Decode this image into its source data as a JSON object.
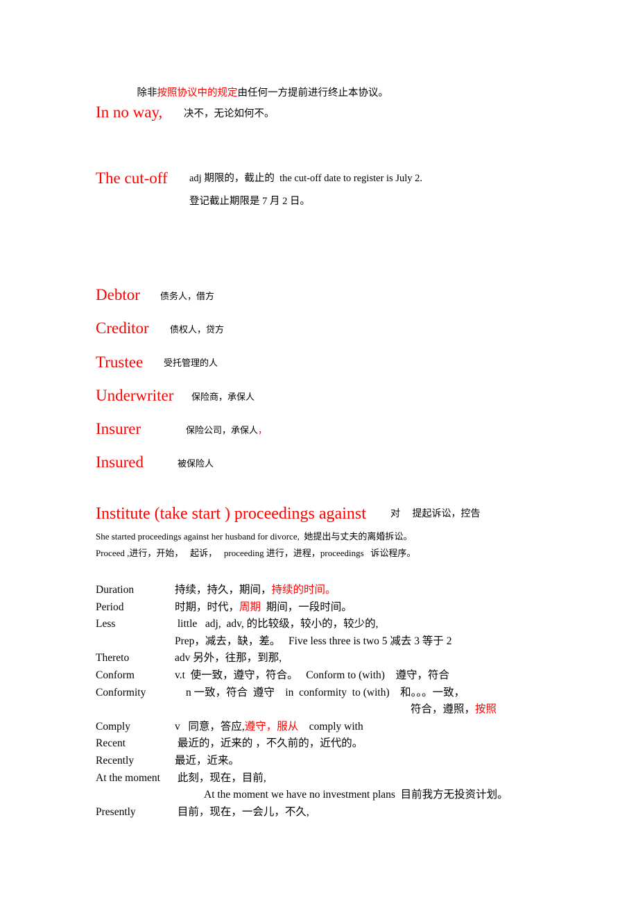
{
  "document": {
    "title": "English-Chinese business vocabulary study notes",
    "colors": {
      "accent_red": "#ff0000",
      "text_black": "#000000",
      "background": "#ffffff"
    }
  },
  "intro": {
    "part1": "除非",
    "part2_red": "按照协议中的规定",
    "part3": "由任何一方提前进行终止本协议。"
  },
  "entries": [
    {
      "headword": "In no way,",
      "gloss": "决不，无论如何不。"
    },
    {
      "headword": "The cut-off",
      "definition_line1": "adj 期限的，截止的  the cut-off date to register is July 2.",
      "definition_line2": "登记截止期限是 7 月 2 日。"
    },
    {
      "headword": "Debtor",
      "gloss": "债务人，借方"
    },
    {
      "headword": "Creditor",
      "gloss": "债权人，贷方"
    },
    {
      "headword": "Trustee",
      "gloss": "受托管理的人"
    },
    {
      "headword": "Underwriter",
      "gloss": "保险商，承保人"
    },
    {
      "headword": "Insurer",
      "gloss": "保险公司，承保人",
      "gloss_red_tail": "，"
    },
    {
      "headword": "Insured",
      "gloss": "被保险人"
    }
  ],
  "institute": {
    "headword": "Institute (take start ) proceedings against",
    "gloss": "对     提起诉讼，控告",
    "example1": "She started proceedings against her husband for divorce,  她提出与丈夫的离婚拆讼。",
    "example2": "Proceed ,进行，开始，   起诉，   proceeding 进行，进程，proceedings   诉讼程序。"
  },
  "vocab_table": {
    "rows": [
      {
        "term": "Duration",
        "segments": [
          {
            "text": "持续，持久，期间，",
            "color": "black"
          },
          {
            "text": "持续的时间。",
            "color": "red"
          }
        ]
      },
      {
        "term": "Period",
        "segments": [
          {
            "text": "时期，时代，",
            "color": "black"
          },
          {
            "text": "周期",
            "color": "red"
          },
          {
            "text": "  期间，一段时间。",
            "color": "black"
          }
        ]
      },
      {
        "term": "Less",
        "segments": [
          {
            "text": " little   adj,  adv, 的比较级，较小的，较少的,",
            "color": "black"
          }
        ]
      },
      {
        "term": "",
        "indent": 114,
        "segments": [
          {
            "text": "Prep，减去，缺，差。   Five less three is two 5 减去 3 等于 2",
            "color": "black"
          }
        ]
      },
      {
        "term": "Thereto",
        "segments": [
          {
            "text": "adv 另外，往那，到那,",
            "color": "black"
          }
        ]
      },
      {
        "term": "Conform",
        "segments": [
          {
            "text": "v.t  使一致，遵守，符合。   Conform to (with)    遵守，符合",
            "color": "black"
          }
        ]
      },
      {
        "term": "Conformity",
        "term_width": 130,
        "segments": [
          {
            "text": "n 一致，符合  遵守    in  conformity  to (with)    和。。。一致，",
            "color": "black"
          }
        ]
      },
      {
        "term": "",
        "indent": 454,
        "segments": [
          {
            "text": "符合，遵照，",
            "color": "black"
          },
          {
            "text": "按照",
            "color": "red"
          }
        ]
      },
      {
        "term": "Comply",
        "segments": [
          {
            "text": "v   同意，答应,",
            "color": "black"
          },
          {
            "text": "遵守，服从",
            "color": "red"
          },
          {
            "text": "    comply with",
            "color": "black"
          }
        ]
      },
      {
        "term": "Recent",
        "segments": [
          {
            "text": " 最近的，近来的 ，不久前的，近代的。",
            "color": "black"
          }
        ]
      },
      {
        "term": "Recently",
        "segments": [
          {
            "text": "最近，近来。",
            "color": "black"
          }
        ]
      },
      {
        "term": "At the moment",
        "term_width": 114,
        "segments": [
          {
            "text": " 此刻，现在，目前,",
            "color": "black"
          }
        ]
      },
      {
        "term": "",
        "indent": 156,
        "segments": [
          {
            "text": "At the moment we have no investment plans  目前我方无投资计划。",
            "color": "black"
          }
        ]
      },
      {
        "term": "Presently",
        "segments": [
          {
            "text": " 目前，现在，一会儿，不久,",
            "color": "black"
          }
        ]
      }
    ]
  }
}
